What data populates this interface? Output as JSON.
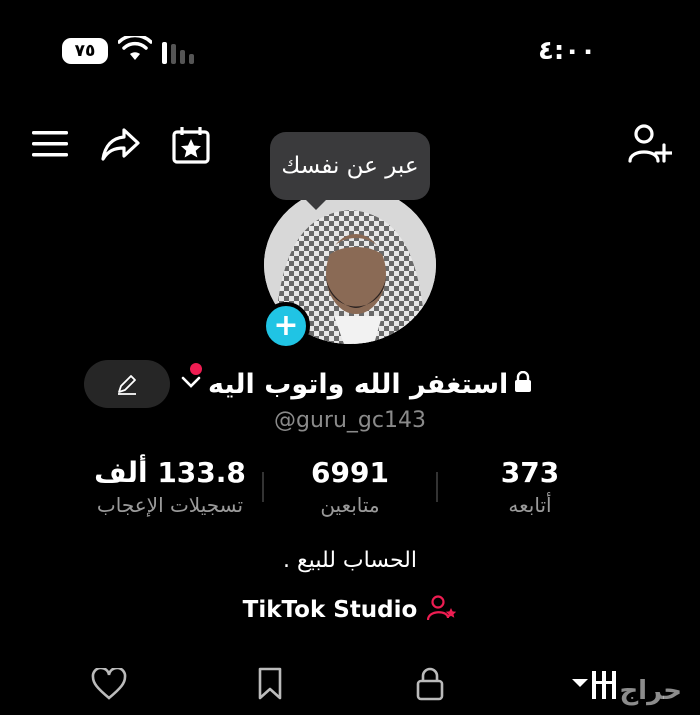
{
  "status_bar": {
    "battery": "٧٥",
    "time": "٤:٠٠"
  },
  "header": {
    "icons": [
      "menu-icon",
      "share-icon",
      "calendar-star-icon",
      "add-user-icon"
    ]
  },
  "tooltip": {
    "text": "عبر عن نفسك"
  },
  "profile": {
    "name": "استغفر الله واتوب اليه",
    "handle": "@guru_gc143",
    "bio": "الحساب للبيع .",
    "studio_label": "TikTok Studio"
  },
  "stats": {
    "likes": {
      "value": "133.8 ألف",
      "label": "تسجيلات الإعجاب"
    },
    "followers": {
      "value": "6991",
      "label": "متابعين"
    },
    "following": {
      "value": "373",
      "label": "أتابعه"
    }
  },
  "tabs": [
    "heart-icon",
    "bookmark-icon",
    "lock-icon",
    "grid-icon"
  ],
  "watermark": "حراج",
  "colors": {
    "accent_cyan": "#20c4e4",
    "accent_red": "#ee1d52",
    "background": "#000000"
  }
}
